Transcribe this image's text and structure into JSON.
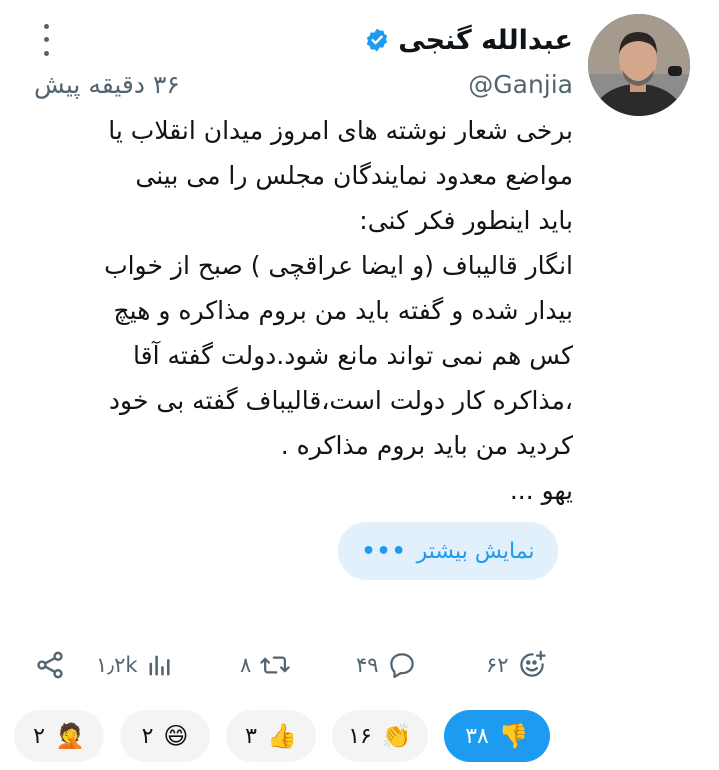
{
  "author": {
    "display_name": "عبدالله گنجی",
    "handle": "@Ganjia",
    "verified": true,
    "verified_color": "#1d9bf0",
    "avatar_icon": "profile-photo"
  },
  "tweet": {
    "time_ago": "۳۶ دقیقه پیش",
    "lines": [
      "برخی شعار نوشته های امروز میدان انقلاب یا",
      "مواضع معدود  نمایندگان مجلس را می بینی",
      "باید اینطور فکر کنی:",
      "انگار قالیباف (و ایضا عراقچی ) صبح از خواب",
      "بیدار شده و گفته باید من بروم مذاکره و هیچ",
      "کس هم نمی تواند مانع شود.دولت گفته آقا",
      "،مذاکره کار دولت است،قالیباف گفته بی خود",
      "کردید من باید بروم مذاکره .",
      "یهو ..."
    ],
    "show_more_label": "نمایش بیشتر",
    "show_more_icon": "ellipsis-icon"
  },
  "actions": {
    "reactions_count": "۶۲",
    "replies_count": "۴۹",
    "retweets_count": "۸",
    "views_count": "۱٫۲k"
  },
  "reactions": [
    {
      "emoji": "👎",
      "count": "۳۸",
      "active": true
    },
    {
      "emoji": "👏",
      "count": "۱۶",
      "active": false
    },
    {
      "emoji": "👍",
      "count": "۳",
      "active": false
    },
    {
      "emoji": "😄",
      "count": "۲",
      "active": false
    },
    {
      "emoji": "🤦",
      "count": "۲",
      "active": false
    }
  ],
  "colors": {
    "accent": "#1d9bf0",
    "muted": "#536471",
    "text": "#0f1419"
  }
}
